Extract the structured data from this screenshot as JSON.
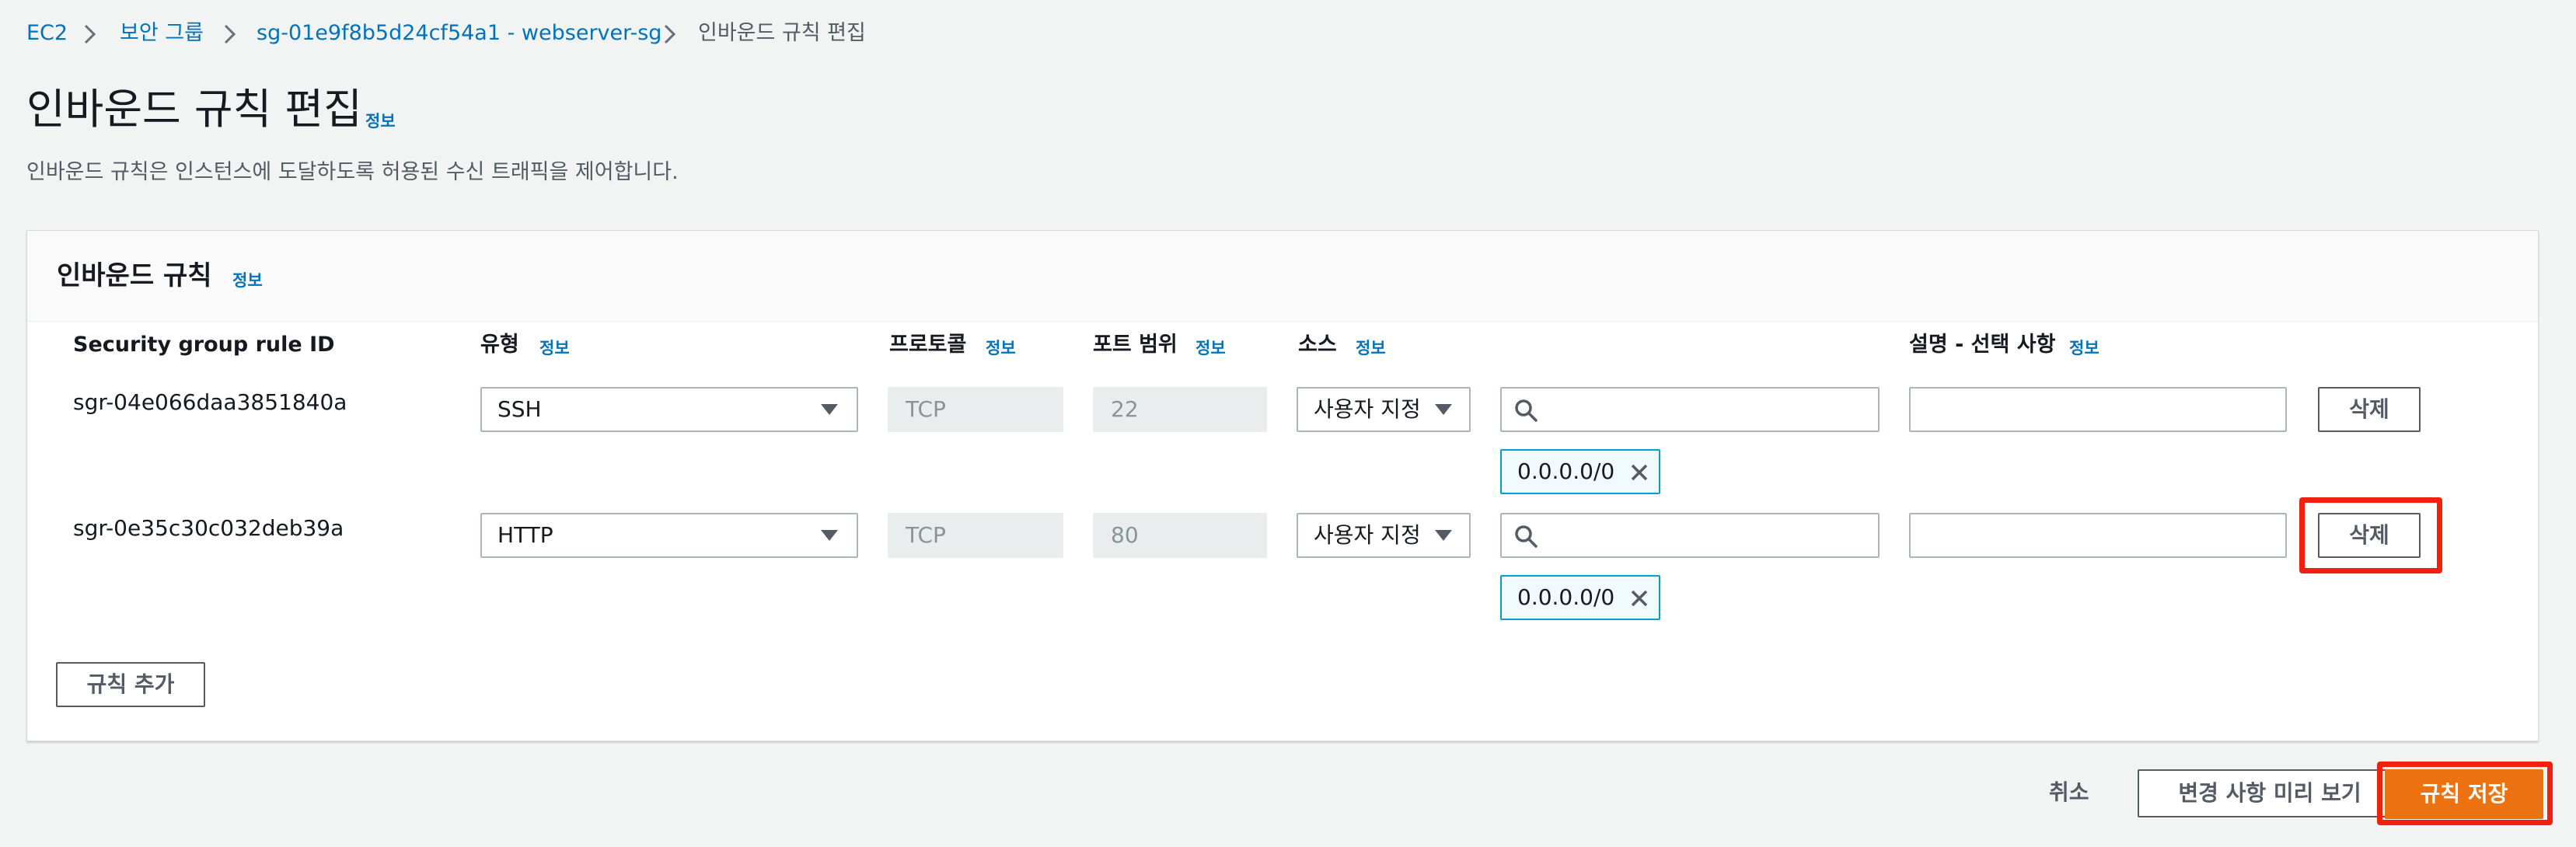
{
  "breadcrumb": {
    "items": [
      "EC2",
      "보안 그룹",
      "sg-01e9f8b5d24cf54a1 - webserver-sg"
    ],
    "current": "인바운드 규칙 편집"
  },
  "page": {
    "title": "인바운드 규칙 편집",
    "info": "정보",
    "description": "인바운드 규칙은 인스턴스에 도달하도록 허용된 수신 트래픽을 제어합니다."
  },
  "panel": {
    "title": "인바운드 규칙",
    "info": "정보"
  },
  "columns": {
    "rule_id": "Security group rule ID",
    "type": "유형",
    "protocol": "프로토콜",
    "port_range": "포트 범위",
    "source": "소스",
    "description": "설명 - 선택 사항",
    "info": "정보"
  },
  "rules": [
    {
      "id": "sgr-04e066daa3851840a",
      "type": "SSH",
      "protocol": "TCP",
      "port": "22",
      "source_type": "사용자 지정",
      "cidr": "0.0.0.0/0",
      "description": "",
      "delete_label": "삭제"
    },
    {
      "id": "sgr-0e35c30c032deb39a",
      "type": "HTTP",
      "protocol": "TCP",
      "port": "80",
      "source_type": "사용자 지정",
      "cidr": "0.0.0.0/0",
      "description": "",
      "delete_label": "삭제"
    }
  ],
  "add_rule_label": "규칙 추가",
  "footer": {
    "cancel_label": "취소",
    "preview_label": "변경 사항 미리 보기",
    "save_label": "규칙 저장"
  },
  "colors": {
    "link": "#0073bb",
    "primary": "#ec7211",
    "highlight": "#f2200c",
    "token_border": "#00a1c9"
  },
  "icons": [
    "chevron-right-icon",
    "search-icon",
    "caret-down-icon",
    "close-icon"
  ]
}
